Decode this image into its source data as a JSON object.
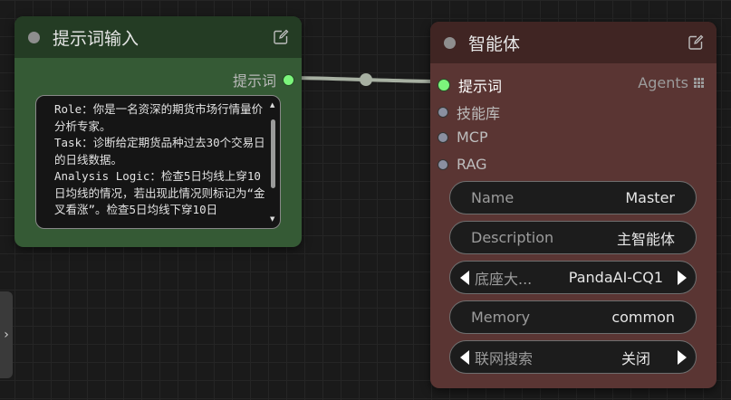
{
  "colors": {
    "canvas_bg": "#1a1a1a",
    "prompt_node_body": "#355a35",
    "prompt_node_header": "#243c24",
    "agent_node_body": "#5a3533",
    "agent_node_header": "#402523",
    "connected_socket": "#7cf57c",
    "wire": "#a7b0a2"
  },
  "sidebar_toggle": {
    "icon": "chevron-right-icon",
    "glyph": "›"
  },
  "prompt_node": {
    "title": "提示词输入",
    "output_label": "提示词",
    "text": "Role：你是一名资深的期货市场行情量价分析专家。\nTask：诊断给定期货品种过去30个交易日的日线数据。\nAnalysis Logic：检查5日均线上穿10日均线的情况，若出现此情况则标记为“金叉看涨”。检查5日均线下穿10日"
  },
  "agent_node": {
    "title": "智能体",
    "type_label": "Agents",
    "inputs": [
      {
        "label": "提示词",
        "connected": true
      },
      {
        "label": "技能库",
        "connected": false
      },
      {
        "label": "MCP",
        "connected": false
      },
      {
        "label": "RAG",
        "connected": false
      }
    ],
    "fields": {
      "name": {
        "label": "Name",
        "value": "Master"
      },
      "description": {
        "label": "Description",
        "value": "主智能体"
      },
      "base_model": {
        "label": "底座大...",
        "value": "PandaAI-CQ1"
      },
      "memory": {
        "label": "Memory",
        "value": "common"
      },
      "web_search": {
        "label": "联网搜索",
        "value": "关闭"
      }
    }
  }
}
